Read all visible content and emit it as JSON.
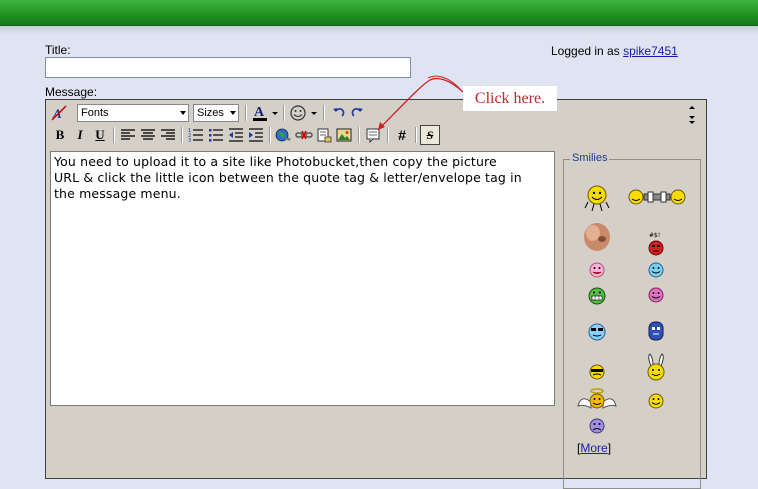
{
  "form": {
    "title_label": "Title:",
    "title_value": "",
    "message_label": "Message:"
  },
  "user": {
    "logged_in_prefix": "Logged in as",
    "username": "spike7451"
  },
  "toolbar": {
    "fonts_value": "Fonts",
    "sizes_value": "Sizes",
    "font_color_glyph": "A",
    "bold_glyph": "B",
    "italic_glyph": "I",
    "underline_glyph": "U",
    "code_glyph": "#",
    "strike_glyph": "S"
  },
  "editor": {
    "body_line1": "You need to upload it to a site like Photobucket,then copy the picture",
    "body_line2": "URL & click the little icon between the quote tag & letter/envelope tag in",
    "body_line3": "the message menu."
  },
  "annotation": {
    "callout_text": "Click here."
  },
  "smilies": {
    "legend": "Smilies",
    "more_open": "[",
    "more_label": "More",
    "more_close": "]"
  },
  "colors": {
    "topbar": "#2a9e2a",
    "page_bg": "#dfe3f2",
    "editor_bg": "#d4d0c8",
    "callout_text": "#c0282a",
    "link": "#1a1ab0"
  }
}
